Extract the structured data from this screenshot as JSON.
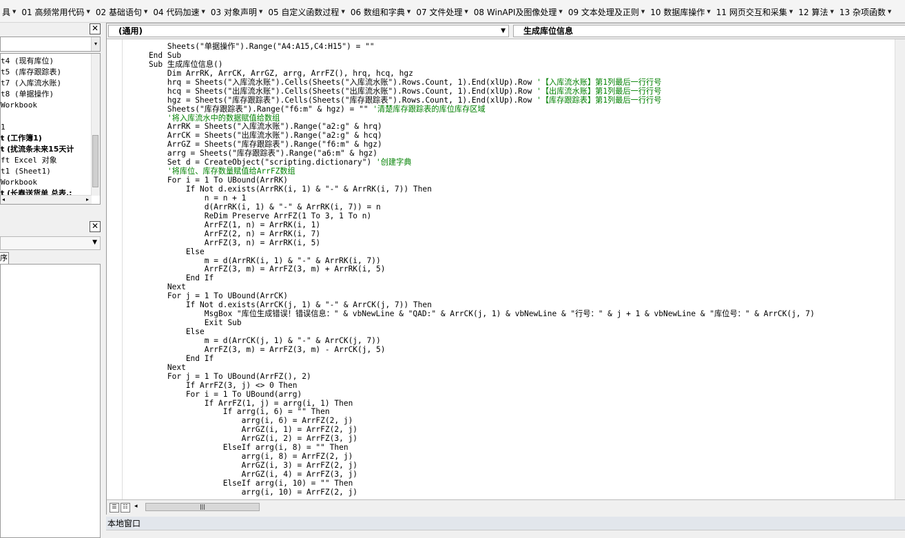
{
  "menu": [
    {
      "label": "具"
    },
    {
      "label": "01 高频常用代码"
    },
    {
      "label": "02 基础语句"
    },
    {
      "label": "04 代码加速"
    },
    {
      "label": "03 对象声明"
    },
    {
      "label": "05 自定义函数过程"
    },
    {
      "label": "06 数组和字典"
    },
    {
      "label": "07 文件处理"
    },
    {
      "label": "08 WinAPI及图像处理"
    },
    {
      "label": "09 文本处理及正则"
    },
    {
      "label": "10 数据库操作"
    },
    {
      "label": "11 网页交互和采集"
    },
    {
      "label": "12 算法"
    },
    {
      "label": "13 杂项函数"
    }
  ],
  "project_tree": [
    {
      "label": "t4 (现有库位)",
      "bold": false
    },
    {
      "label": "t5 (库存跟踪表)",
      "bold": false
    },
    {
      "label": "t7 (入库流水账)",
      "bold": false
    },
    {
      "label": "t8 (单据操作)",
      "bold": false
    },
    {
      "label": "Workbook",
      "bold": false
    },
    {
      "label": "",
      "bold": false
    },
    {
      "label": "1",
      "bold": false
    },
    {
      "label": "t (工作簿1)",
      "bold": true
    },
    {
      "label": "t (扰流条未来15天计",
      "bold": true
    },
    {
      "label": "ft Excel 对象",
      "bold": false
    },
    {
      "label": "t1 (Sheet1)",
      "bold": false
    },
    {
      "label": "Workbook",
      "bold": false
    },
    {
      "label": "t (长春送货单 总表.:",
      "bold": true
    }
  ],
  "properties_tab_label": "序",
  "code_window": {
    "object_selector": "(通用)",
    "procedure_selector": "生成库位信息"
  },
  "code_lines": [
    {
      "text": "        Sheets(\"单据操作\").Range(\"A4:A15,C4:H15\") = \"\"",
      "comment": ""
    },
    {
      "text": "    End Sub",
      "comment": ""
    },
    {
      "text": "    Sub 生成库位信息()",
      "comment": ""
    },
    {
      "text": "        Dim ArrRK, ArrCK, ArrGZ, arrg, ArrFZ(), hrq, hcq, hgz",
      "comment": ""
    },
    {
      "text": "        hrq = Sheets(\"入库流水账\").Cells(Sheets(\"入库流水账\").Rows.Count, 1).End(xlUp).Row ",
      "comment": "'【入库流水账】第1列最后一行行号"
    },
    {
      "text": "        hcq = Sheets(\"出库流水账\").Cells(Sheets(\"出库流水账\").Rows.Count, 1).End(xlUp).Row ",
      "comment": "'【出库流水账】第1列最后一行行号"
    },
    {
      "text": "        hgz = Sheets(\"库存跟踪表\").Cells(Sheets(\"库存跟踪表\").Rows.Count, 1).End(xlUp).Row ",
      "comment": "'【库存跟踪表】第1列最后一行行号"
    },
    {
      "text": "        Sheets(\"库存跟踪表\").Range(\"f6:m\" & hgz) = \"\" ",
      "comment": "'清楚库存跟踪表的库位库存区域"
    },
    {
      "text": "        ",
      "comment": "'将入库流水中的数据赋值给数组"
    },
    {
      "text": "        ArrRK = Sheets(\"入库流水账\").Range(\"a2:g\" & hrq)",
      "comment": ""
    },
    {
      "text": "        ArrCK = Sheets(\"出库流水账\").Range(\"a2:g\" & hcq)",
      "comment": ""
    },
    {
      "text": "        ArrGZ = Sheets(\"库存跟踪表\").Range(\"f6:m\" & hgz)",
      "comment": ""
    },
    {
      "text": "        arrg = Sheets(\"库存跟踪表\").Range(\"a6:m\" & hgz)",
      "comment": ""
    },
    {
      "text": "        Set d = CreateObject(\"scripting.dictionary\") ",
      "comment": "'创建字典"
    },
    {
      "text": "        ",
      "comment": "'将库位、库存数量赋值给ArrFZ数组"
    },
    {
      "text": "        For i = 1 To UBound(ArrRK)",
      "comment": ""
    },
    {
      "text": "            If Not d.exists(ArrRK(i, 1) & \"-\" & ArrRK(i, 7)) Then",
      "comment": ""
    },
    {
      "text": "                n = n + 1",
      "comment": ""
    },
    {
      "text": "                d(ArrRK(i, 1) & \"-\" & ArrRK(i, 7)) = n",
      "comment": ""
    },
    {
      "text": "                ReDim Preserve ArrFZ(1 To 3, 1 To n)",
      "comment": ""
    },
    {
      "text": "                ArrFZ(1, n) = ArrRK(i, 1)",
      "comment": ""
    },
    {
      "text": "                ArrFZ(2, n) = ArrRK(i, 7)",
      "comment": ""
    },
    {
      "text": "                ArrFZ(3, n) = ArrRK(i, 5)",
      "comment": ""
    },
    {
      "text": "            Else",
      "comment": ""
    },
    {
      "text": "                m = d(ArrRK(i, 1) & \"-\" & ArrRK(i, 7))",
      "comment": ""
    },
    {
      "text": "                ArrFZ(3, m) = ArrFZ(3, m) + ArrRK(i, 5)",
      "comment": ""
    },
    {
      "text": "            End If",
      "comment": ""
    },
    {
      "text": "        Next",
      "comment": ""
    },
    {
      "text": "        For j = 1 To UBound(ArrCK)",
      "comment": ""
    },
    {
      "text": "            If Not d.exists(ArrCK(j, 1) & \"-\" & ArrCK(j, 7)) Then",
      "comment": ""
    },
    {
      "text": "                MsgBox \"库位生成错误！错误信息：\" & vbNewLine & \"QAD:\" & ArrCK(j, 1) & vbNewLine & \"行号：\" & j + 1 & vbNewLine & \"库位号：\" & ArrCK(j, 7)",
      "comment": ""
    },
    {
      "text": "                Exit Sub",
      "comment": ""
    },
    {
      "text": "            Else",
      "comment": ""
    },
    {
      "text": "                m = d(ArrCK(j, 1) & \"-\" & ArrCK(j, 7))",
      "comment": ""
    },
    {
      "text": "                ArrFZ(3, m) = ArrFZ(3, m) - ArrCK(j, 5)",
      "comment": ""
    },
    {
      "text": "            End If",
      "comment": ""
    },
    {
      "text": "        Next",
      "comment": ""
    },
    {
      "text": "        For j = 1 To UBound(ArrFZ(), 2)",
      "comment": ""
    },
    {
      "text": "            If ArrFZ(3, j) <> 0 Then",
      "comment": ""
    },
    {
      "text": "            For i = 1 To UBound(arrg)",
      "comment": ""
    },
    {
      "text": "                If ArrFZ(1, j) = arrg(i, 1) Then",
      "comment": ""
    },
    {
      "text": "                    If arrg(i, 6) = \"\" Then",
      "comment": ""
    },
    {
      "text": "                        arrg(i, 6) = ArrFZ(2, j)",
      "comment": ""
    },
    {
      "text": "                        ArrGZ(i, 1) = ArrFZ(2, j)",
      "comment": ""
    },
    {
      "text": "                        ArrGZ(i, 2) = ArrFZ(3, j)",
      "comment": ""
    },
    {
      "text": "                    ElseIf arrg(i, 8) = \"\" Then",
      "comment": ""
    },
    {
      "text": "                        arrg(i, 8) = ArrFZ(2, j)",
      "comment": ""
    },
    {
      "text": "                        ArrGZ(i, 3) = ArrFZ(2, j)",
      "comment": ""
    },
    {
      "text": "                        ArrGZ(i, 4) = ArrFZ(3, j)",
      "comment": ""
    },
    {
      "text": "                    ElseIf arrg(i, 10) = \"\" Then",
      "comment": ""
    },
    {
      "text": "                        arrg(i, 10) = ArrFZ(2, j)",
      "comment": ""
    }
  ],
  "local_window": {
    "title": "本地窗口"
  },
  "colors": {
    "comment": "#008000",
    "keyword": "#00008b",
    "titlebar": "#e2e6ec"
  },
  "icons": {
    "close": "close-icon",
    "dropdown": "chevron-down-icon"
  }
}
